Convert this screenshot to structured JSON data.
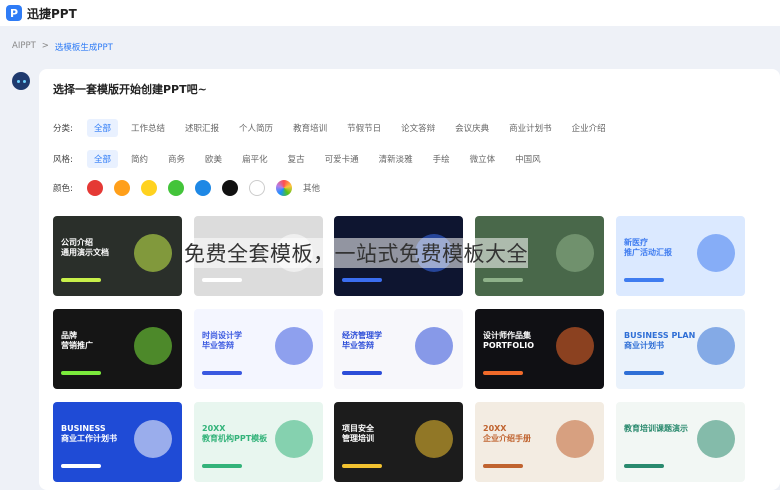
{
  "app": {
    "logo_letter": "P",
    "name": "迅捷PPT"
  },
  "breadcrumb": {
    "root": "AIPPT",
    "sep": ">",
    "current": "选模板生成PPT"
  },
  "prompt": "选择一套模版开始创建PPT吧~",
  "category": {
    "label": "分类:",
    "items": [
      "全部",
      "工作总结",
      "述职汇报",
      "个人简历",
      "教育培训",
      "节假节日",
      "论文答辩",
      "会议庆典",
      "商业计划书",
      "企业介绍"
    ]
  },
  "style": {
    "label": "风格:",
    "items": [
      "全部",
      "简约",
      "商务",
      "欧美",
      "扁平化",
      "复古",
      "可爱卡通",
      "清新淡雅",
      "手绘",
      "微立体",
      "中国风"
    ]
  },
  "color": {
    "label": "颜色:",
    "swatches": [
      "#e53935",
      "#ff9f1a",
      "#ffd21f",
      "#43c43a",
      "#1e88e5",
      "#111111",
      "#ffffff",
      "rainbow"
    ],
    "other": "其他"
  },
  "templates": [
    {
      "title": "公司介绍\n通用演示文档",
      "bg": "#2a2f2a",
      "accent": "#c8f04a"
    },
    {
      "title": "",
      "bg": "#dcdcdc",
      "accent": "#ffffff"
    },
    {
      "title": "",
      "bg": "#0e1530",
      "accent": "#3b6ef0"
    },
    {
      "title": "",
      "bg": "#49684a",
      "accent": "#8fb28a"
    },
    {
      "title": "新医疗\n推广活动汇报",
      "bg": "#dbe9ff",
      "accent": "#3f7cf0"
    },
    {
      "title": "品牌\n营销推广",
      "bg": "#151515",
      "accent": "#7bea3c"
    },
    {
      "title": "时尚设计学\n毕业答辩",
      "bg": "#f4f6ff",
      "accent": "#3a59e0"
    },
    {
      "title": "经济管理学\n毕业答辩",
      "bg": "#f7f7fb",
      "accent": "#2c4dd8"
    },
    {
      "title": "设计师作品集\nPORTFOLIO",
      "bg": "#101014",
      "accent": "#f06a2a"
    },
    {
      "title": "BUSINESS PLAN\n商业计划书",
      "bg": "#eaf2fb",
      "accent": "#2f6fd6"
    },
    {
      "title": "BUSINESS\n商业工作计划书",
      "bg": "#1f4bd6",
      "accent": "#ffffff"
    },
    {
      "title": "20XX\n教育机构PPT模板",
      "bg": "#e8f6ef",
      "accent": "#33b37a"
    },
    {
      "title": "项目安全\n管理培训",
      "bg": "#1c1c1c",
      "accent": "#f2c230"
    },
    {
      "title": "20XX\n企业介绍手册",
      "bg": "#f3ece2",
      "accent": "#c0632f"
    },
    {
      "title": "教育培训课题演示",
      "bg": "#f2f7f4",
      "accent": "#2a8a6e"
    }
  ],
  "overlay_caption": "免费全套模板，一站式免费模板大全"
}
